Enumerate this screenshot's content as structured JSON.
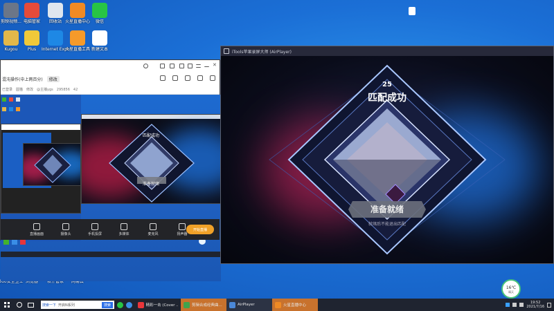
{
  "desktop": {
    "icons_top": [
      {
        "label": "剪映视频...",
        "color": "#6b7688"
      },
      {
        "label": "电脑管家",
        "color": "#e54b3a"
      },
      {
        "label": "回收站",
        "color": "#dfe6ee"
      },
      {
        "label": "火星直播中心",
        "color": "#f08a24"
      },
      {
        "label": "微信",
        "color": "#28c445"
      }
    ],
    "icons_row2": [
      {
        "label": "Kugou",
        "color": "#e3b84a"
      },
      {
        "label": "Plus",
        "color": "#f0c93a"
      },
      {
        "label": "Internet Explorer",
        "color": "#1e88e5"
      },
      {
        "label": "火星直播工具",
        "color": "#f59a2a"
      },
      {
        "label": "新建文本",
        "color": "#ffffff"
      }
    ],
    "icons_bottom": [
      {
        "label": "360安全卫士",
        "color": "#43b22e"
      },
      {
        "label": "浏览器",
        "color": "#3a8ee6"
      },
      {
        "label": "软件管家",
        "color": "#f5a62b"
      },
      {
        "label": "网易云",
        "color": "#e8353a"
      }
    ]
  },
  "stream_app": {
    "room_title": "混沌操作(中上两百分)",
    "room_tag": "修改",
    "stats": [
      "已登录",
      "圆猫",
      "修改",
      "@主播ygs",
      "295856",
      "42"
    ],
    "bottom_buttons": [
      {
        "label": "直播画面",
        "icon": "screen-icon"
      },
      {
        "label": "摄像头",
        "icon": "camera-icon"
      },
      {
        "label": "手机投屏",
        "icon": "phone-cast-icon"
      },
      {
        "label": "多媒体",
        "icon": "media-icon"
      },
      {
        "label": "麦克风",
        "icon": "mic-icon"
      },
      {
        "label": "扬声器",
        "icon": "speaker-icon"
      }
    ],
    "golive_label": "开始直播",
    "accent": "#f0a128"
  },
  "airplayer": {
    "title": "iTools苹果录屏大师 (AirPlayer)",
    "game": {
      "countdown": "25",
      "match_text": "匹配成功",
      "ready_button": "准备就绪",
      "hint": "就绪后不能退出匹配"
    }
  },
  "nested": {
    "match_text": "匹配成功",
    "ready_button": "准备就绪"
  },
  "taskbar": {
    "search_hint": "搜索一下",
    "search_placeholder": "开启N系列",
    "search_button": "搜索",
    "items": [
      {
        "label": "精彩一击 (Cover ...",
        "color": "#e8353a"
      },
      {
        "label": "剪辑合成经典曲...",
        "color": "#3fa34d"
      },
      {
        "label": "AirPlayer",
        "color": "#4b88d8"
      },
      {
        "label": "火星直播中心",
        "color": "#f08a24"
      }
    ],
    "clock_time": "19:52",
    "clock_date": "2021/7/16",
    "weather_temp": "16℃",
    "weather_label": "晴天"
  }
}
